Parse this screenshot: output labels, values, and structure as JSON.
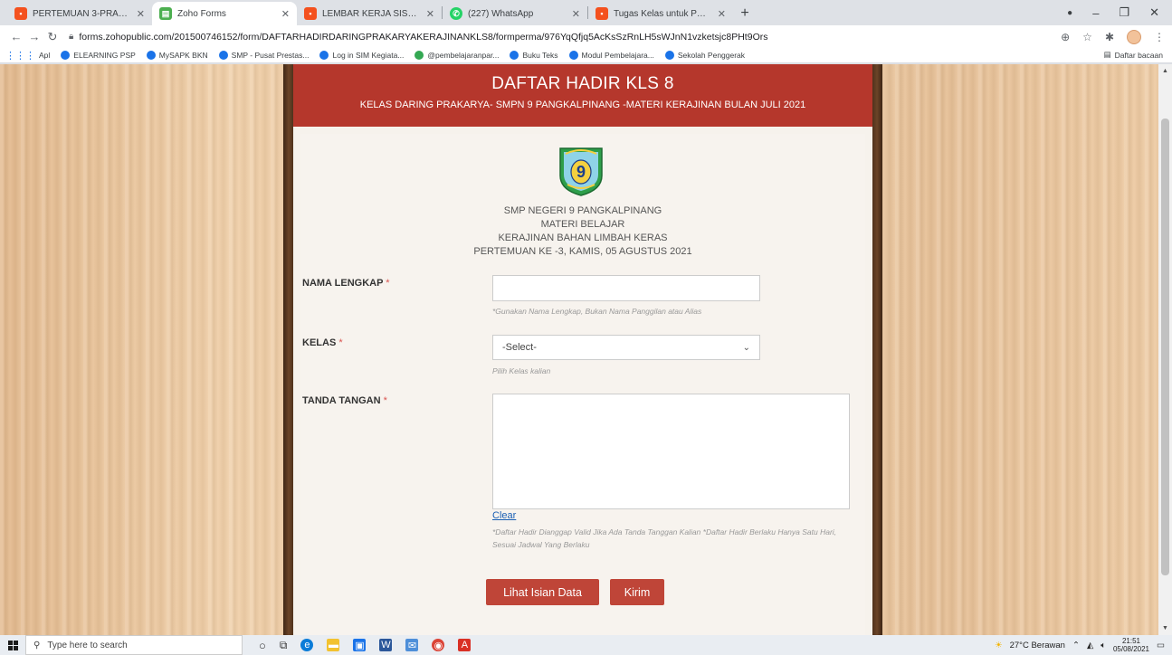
{
  "browser": {
    "tabs": [
      {
        "label": "PERTEMUAN 3-PRAKARYA",
        "icon": "slides-icon",
        "color": "#f4511e",
        "active": false
      },
      {
        "label": "Zoho Forms",
        "icon": "form-icon",
        "color": "#4caf50",
        "active": true
      },
      {
        "label": "LEMBAR KERJA SISWA-PERTEMU",
        "icon": "slides-icon",
        "color": "#f4511e",
        "active": false
      },
      {
        "label": "(227) WhatsApp",
        "icon": "whatsapp-icon",
        "color": "#25d366",
        "active": false
      },
      {
        "label": "Tugas Kelas untuk PRAKARYA KE",
        "icon": "slides-icon",
        "color": "#f4511e",
        "active": false
      }
    ],
    "new_tab": "+",
    "window_controls": [
      "–",
      "❐",
      "✕"
    ],
    "url": "forms.zohopublic.com/201500746152/form/DAFTARHADIRDARINGPRAKARYAKERAJINANKLS8/formperma/976YqQfjq5AcKsSzRnLH5sWJnN1vzketsjc8PHt9Ors",
    "bookmarks": [
      "Apl",
      "ELEARNING PSP",
      "MySAPK BKN",
      "SMP - Pusat Prestas...",
      "Log in SIM Kegiata...",
      "@pembelajaranpar...",
      "Buku Teks",
      "Modul Pembelajara...",
      "Sekolah Penggerak"
    ],
    "reading_list": "Daftar bacaan"
  },
  "form": {
    "title": "DAFTAR HADIR KLS 8",
    "subtitle": "KELAS DARING PRAKARYA- SMPN 9 PANGKALPINANG -MATERI KERAJINAN BULAN JULI 2021",
    "logo_text": "9",
    "school_info": [
      "SMP NEGERI 9 PANGKALPINANG",
      "MATERI BELAJAR",
      "KERAJINAN BAHAN LIMBAH KERAS",
      "PERTEMUAN KE -3, KAMIS, 05 AGUSTUS 2021"
    ],
    "name_field": {
      "label": "NAMA LENGKAP",
      "required_mark": "*",
      "value": "",
      "hint": "*Gunakan Nama Lengkap, Bukan Nama Panggilan atau Alias"
    },
    "class_field": {
      "label": "KELAS",
      "required_mark": "*",
      "selected": "-Select-",
      "hint": "Pilih Kelas kalian"
    },
    "signature_field": {
      "label": "TANDA TANGAN",
      "required_mark": "*",
      "clear_label": "Clear",
      "note": "*Daftar Hadir Dianggap Valid Jika Ada Tanda Tanggan Kalian *Daftar Hadir Berlaku Hanya Satu Hari, Sesuai Jadwal Yang Berlaku"
    },
    "buttons": {
      "view_data": "Lihat Isian Data",
      "submit": "Kirim"
    },
    "colors": {
      "header": "#b5372c",
      "button": "#bf4538",
      "required": "#d9534f"
    }
  },
  "taskbar": {
    "search_placeholder": "Type here to search",
    "weather": "27°C Berawan",
    "time": "21:51",
    "date": "05/08/2021"
  }
}
